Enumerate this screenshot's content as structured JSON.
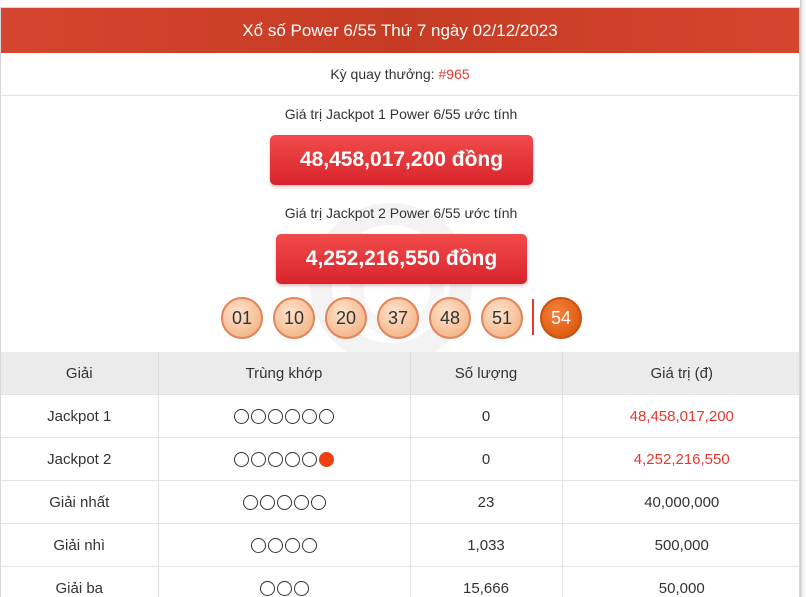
{
  "header": {
    "title": "Xổ số Power 6/55 Thứ 7 ngày 02/12/2023"
  },
  "period": {
    "label": "Kỳ quay thưởng:",
    "number": "#965"
  },
  "jackpots": [
    {
      "label": "Giá trị Jackpot 1 Power 6/55 ước tính",
      "value": "48,458,017,200 đồng"
    },
    {
      "label": "Giá trị Jackpot 2 Power 6/55 ước tính",
      "value": "4,252,216,550 đồng"
    }
  ],
  "balls": [
    "01",
    "10",
    "20",
    "37",
    "48",
    "51"
  ],
  "power_ball": "54",
  "colors": {
    "header": "#d5452f",
    "accent_red": "#e5392f",
    "ball_fill": "#f7c39d",
    "power_ball": "#e46319"
  },
  "table": {
    "headers": [
      "Giải",
      "Trùng khớp",
      "Số lượng",
      "Giá trị (đ)"
    ],
    "rows": [
      {
        "prize": "Jackpot 1",
        "match_count": 6,
        "power_match": false,
        "quantity": "0",
        "value": "48,458,017,200",
        "value_highlight": true
      },
      {
        "prize": "Jackpot 2",
        "match_count": 5,
        "power_match": true,
        "quantity": "0",
        "value": "4,252,216,550",
        "value_highlight": true
      },
      {
        "prize": "Giải nhất",
        "match_count": 5,
        "power_match": false,
        "quantity": "23",
        "value": "40,000,000",
        "value_highlight": false
      },
      {
        "prize": "Giải nhì",
        "match_count": 4,
        "power_match": false,
        "quantity": "1,033",
        "value": "500,000",
        "value_highlight": false
      },
      {
        "prize": "Giải ba",
        "match_count": 3,
        "power_match": false,
        "quantity": "15,666",
        "value": "50,000",
        "value_highlight": false
      }
    ]
  }
}
